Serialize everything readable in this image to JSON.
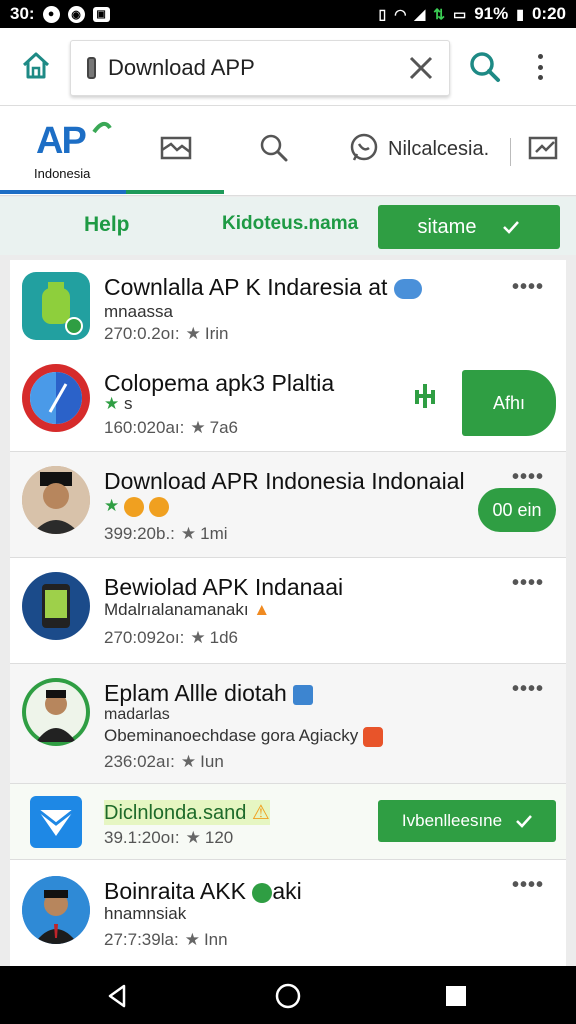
{
  "status_bar": {
    "left_text": "30:",
    "right_text": "91% ▮ 0:20",
    "battery": "91%",
    "time": "0:20"
  },
  "address_bar": {
    "url": "Download APP"
  },
  "tabs": {
    "logo_text": "AP",
    "logo_sub": "Indonesia",
    "text_tab": "Nilcalcesia."
  },
  "filters": {
    "help": "Help",
    "link": "Kidoteus.nama",
    "button": "sitame"
  },
  "apps": [
    {
      "title": "Cownlalla AP K Indaresia at",
      "sub": "mnaassa",
      "meta_a": "270:0.2oı:",
      "meta_b": "Irin",
      "more": "••••",
      "action": "Afhı"
    },
    {
      "title": "Colopema apk3 Plaltia",
      "sub": "s",
      "meta_a": "160:020aı:",
      "meta_b": "7a6"
    },
    {
      "title": "Download APR Indonesia Indonaial",
      "sub": "",
      "meta_a": "399:20b.:",
      "meta_b": "1mi",
      "more": "••••",
      "action": "00 ein"
    },
    {
      "title": "Bewiolad APK Indanaai",
      "sub": "Mdalrıalanamanakı",
      "meta_a": "270:092oı:",
      "meta_b": "1d6",
      "more": "••••"
    },
    {
      "title": "Eplam Allle diotah",
      "sub": "madarlas",
      "sub2": "Obeminanoechdase gora Agiacky",
      "meta_a": "236:02aı:",
      "meta_b": "Iun",
      "more": "••••"
    },
    {
      "title": "Diclnlonda.sand",
      "meta_a": "39.1:20oı:",
      "meta_b": "120",
      "action": "Ivbenlleesıne"
    },
    {
      "title": "Boinraita AKK",
      "title_tail": "aki",
      "sub": "hnamnsiak",
      "meta_a": "27:7:39la:",
      "meta_b": "Inn",
      "more": "••••"
    }
  ],
  "colors": {
    "accent_green": "#2f9e43",
    "brand_blue": "#1d6ec5",
    "text_green": "#1e9a44"
  }
}
